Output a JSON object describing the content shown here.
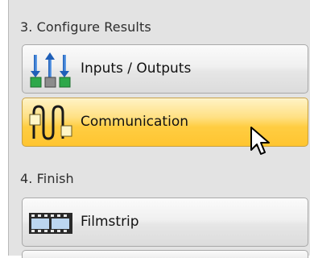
{
  "sections": [
    {
      "header": "3. Configure Results",
      "items": [
        {
          "label": "Inputs / Outputs",
          "icon": "inputs-outputs-icon",
          "state": "normal"
        },
        {
          "label": "Communication",
          "icon": "communication-icon",
          "state": "hover"
        }
      ]
    },
    {
      "header": "4. Finish",
      "items": [
        {
          "label": "Filmstrip",
          "icon": "filmstrip-icon",
          "state": "normal"
        }
      ]
    }
  ],
  "colors": {
    "panel_bg": "#e3e3e3",
    "button_hover": "#ffcd42",
    "io_green": "#2ea84a",
    "io_blue": "#3d7fd6"
  }
}
